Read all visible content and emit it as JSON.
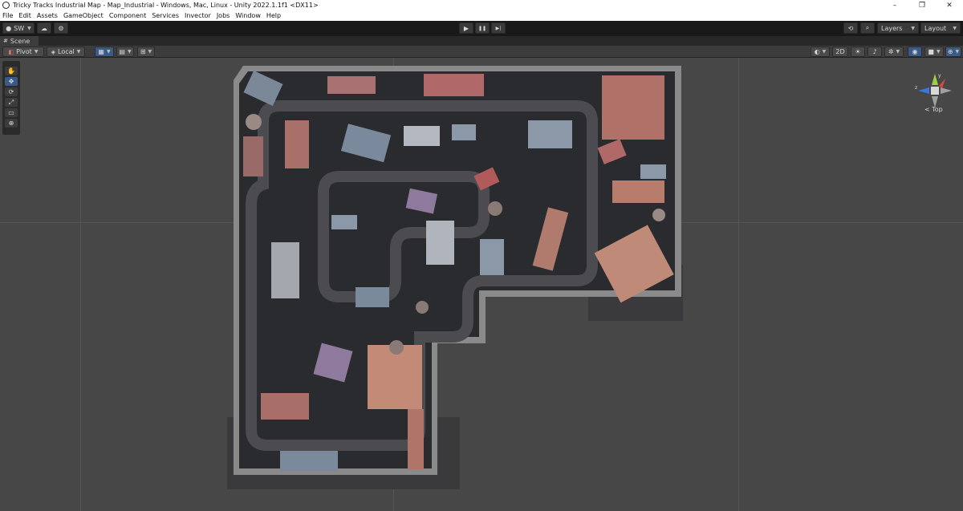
{
  "window": {
    "title": "Tricky Tracks Industrial Map - Map_Industrial - Windows, Mac, Linux - Unity 2022.1.1f1 <DX11>",
    "controls": {
      "minimize": "–",
      "restore": "❐",
      "close": "✕"
    }
  },
  "menu": [
    "File",
    "Edit",
    "Assets",
    "GameObject",
    "Component",
    "Services",
    "Invector",
    "Jobs",
    "Window",
    "Help"
  ],
  "toolbar": {
    "account_label": "SW",
    "play_glyph": "▶",
    "pause_glyph": "❚❚",
    "step_glyph": "▶|",
    "layers_label": "Layers",
    "layout_label": "Layout"
  },
  "scene_tab": {
    "label": "Scene"
  },
  "scene_toolbar": {
    "pivot_label": "Pivot",
    "local_label": "Local",
    "mode_2d_label": "2D"
  },
  "gizmo": {
    "view_label": "< Top",
    "axis_y": "y",
    "axis_z": "z"
  },
  "icons": {
    "hand": "✋",
    "move": "✥",
    "rotate": "⟳",
    "scale": "⤢",
    "rect": "▭",
    "transform": "⊕",
    "history": "⟲",
    "search": "⌕",
    "cloud": "☁",
    "collab": "⚙"
  },
  "colors": {
    "accent": "#3b5a88",
    "viewport_bg": "#474747",
    "toolbar_bg": "#191919",
    "gizmo_y": "#a0d040",
    "gizmo_x": "#d84a3a",
    "gizmo_z": "#3a78d8"
  }
}
